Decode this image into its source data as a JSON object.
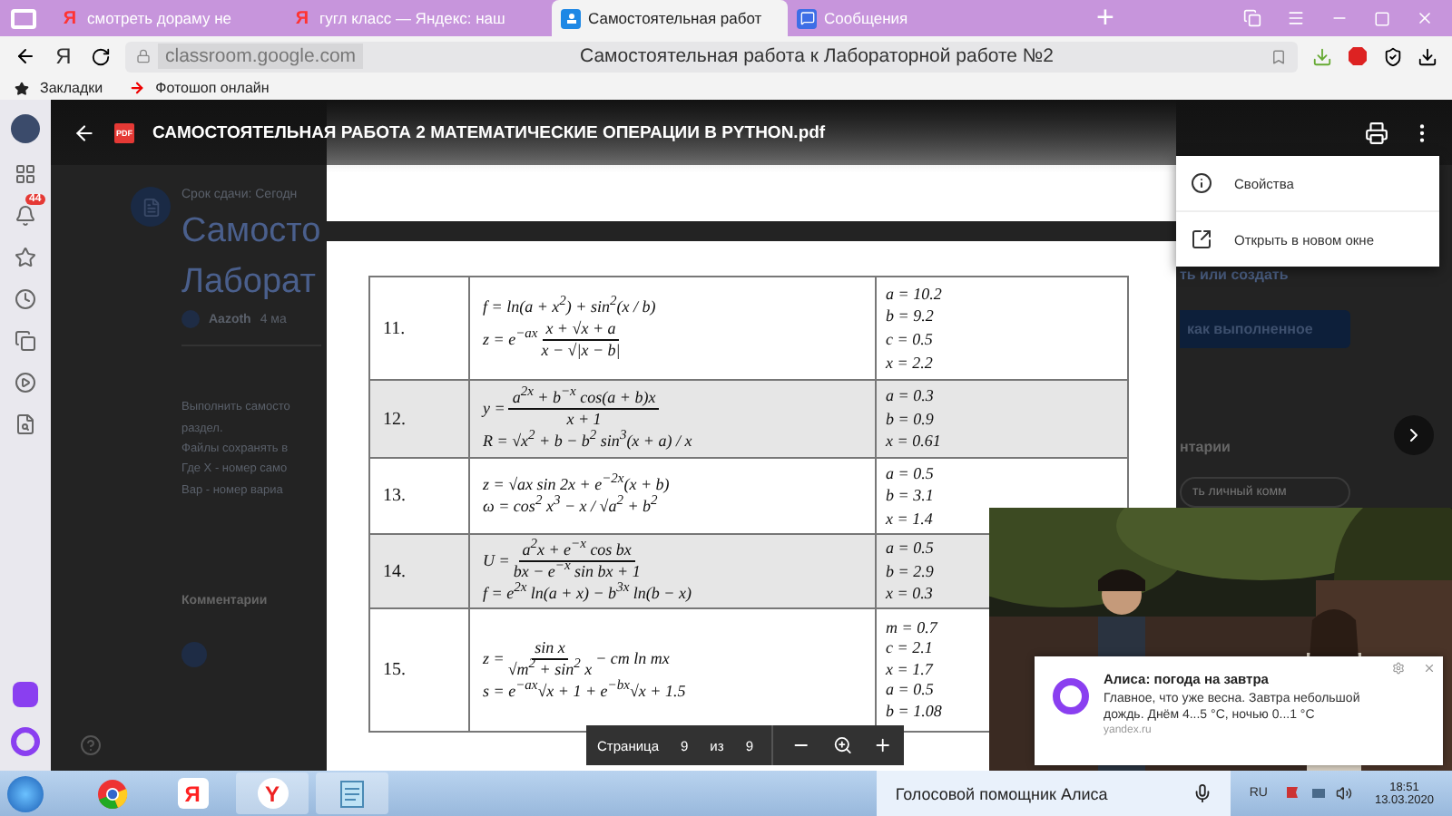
{
  "browser": {
    "tabs": [
      {
        "title": "смотреть дораму не",
        "kind": "yandex",
        "icon_text": "Я",
        "selected": false
      },
      {
        "title": "гугл класс — Яндекс: наш",
        "kind": "yandex",
        "icon_text": "Я",
        "selected": false
      },
      {
        "title": "Самостоятельная работ",
        "kind": "classroom",
        "selected": true
      },
      {
        "title": "Сообщения",
        "kind": "messages",
        "selected": false
      }
    ],
    "new_tab": "+",
    "logo": "Я",
    "url": "classroom.google.com",
    "page_title": "Самостоятельная работа к Лабораторной работе №2",
    "bookmarks": [
      {
        "label": "Закладки",
        "kind": "star"
      },
      {
        "label": "Фотошоп онлайн",
        "kind": "arrow"
      }
    ]
  },
  "sidebar": {
    "badge": "44"
  },
  "classroom": {
    "due": "Срок сдачи: Сегодн",
    "title_lines": [
      "Самосто",
      "Лаборат"
    ],
    "author": "Aazoth",
    "date": "4 ма",
    "description": [
      "Выполнить самосто",
      "раздел.",
      "Файлы сохранять в",
      "Где Х - номер само",
      "Вар - номер вариа"
    ],
    "comments": "Комментарии",
    "work_hint": "ть или создать",
    "done_button": "как выполненное",
    "private_comments": "нтарии",
    "comment_placeholder": "ть личный комм"
  },
  "viewer": {
    "file_badge": "PDF",
    "file_name": "САМОСТОЯТЕЛЬНАЯ РАБОТА 2 МАТЕМАТИЧЕСКИЕ ОПЕРАЦИИ В PYTHON.pdf",
    "menu": [
      {
        "label": "Свойства",
        "kind": "info"
      },
      {
        "label": "Открыть в новом окне",
        "kind": "open"
      }
    ],
    "pager": {
      "label": "Страница",
      "page": "9",
      "of": "из",
      "total": "9"
    }
  },
  "table": {
    "rows": [
      {
        "number": "11.",
        "shaded": false,
        "formulas": [
          [
            "f = ln(a + x$^{2}$) + sin$^{2}$(x / b)"
          ],
          [
            "z = e$^{−ax}$ ",
            {
              "num": "x + √x + a",
              "den": "x − √|x − b|"
            }
          ]
        ],
        "values": [
          "a = 10.2",
          "b = 9.2",
          "c = 0.5",
          "x = 2.2"
        ]
      },
      {
        "number": "12.",
        "shaded": true,
        "formulas": [
          [
            "y = ",
            {
              "num": "a$^{2x}$ + b$^{−x}$ cos(a + b)x",
              "den": "x + 1"
            }
          ],
          [
            "R = √x$^{2}$ + b − b$^{2}$ sin$^{3}$(x + a) / x"
          ]
        ],
        "values": [
          "a = 0.3",
          "b = 0.9",
          "x = 0.61"
        ]
      },
      {
        "number": "13.",
        "shaded": false,
        "formulas": [
          [
            "z = √ax sin 2x + e$^{−2x}$(x + b)"
          ],
          [
            "ω = cos$^{2}$ x$^{3}$ − x / √a$^{2}$ + b$^{2}$"
          ]
        ],
        "values": [
          "a = 0.5",
          "b = 3.1",
          "x = 1.4"
        ]
      },
      {
        "number": "14.",
        "shaded": true,
        "formulas": [
          [
            "U = ",
            {
              "num": "a$^{2}$x + e$^{−x}$ cos bx",
              "den": "bx − e$^{−x}$ sin bx + 1"
            }
          ],
          [
            "f = e$^{2x}$ ln(a + x) − b$^{3x}$ ln(b − x)"
          ]
        ],
        "values": [
          "a = 0.5",
          "b = 2.9",
          "x = 0.3"
        ]
      },
      {
        "number": "15.",
        "shaded": false,
        "formulas": [
          [
            "z = ",
            {
              "num": "sin x",
              "den": "√m$^{2}$ + sin$^{2}$ x"
            },
            " − cm ln mx"
          ],
          [
            "s = e$^{−ax}$√x + 1 + e$^{−bx}$√x + 1.5"
          ]
        ],
        "values": [
          "m = 0.7",
          "c = 2.1",
          "x = 1.7",
          "a = 0.5",
          "b = 1.08"
        ]
      }
    ]
  },
  "notification": {
    "title": "Алиса: погода на завтра",
    "text": "Главное, что уже весна. Завтра небольшой дождь. Днём 4...5 °C, ночью 0...1 °C",
    "source": "yandex.ru"
  },
  "taskbar": {
    "apps": [
      {
        "kind": "chrome"
      },
      {
        "kind": "yandex",
        "text": "Я"
      },
      {
        "kind": "yandex-browser",
        "text": "Y"
      },
      {
        "kind": "notepad"
      }
    ],
    "search_placeholder": "Голосовой помощник Алиса",
    "language": "RU",
    "time": "18:51",
    "date": "13.03.2020"
  }
}
